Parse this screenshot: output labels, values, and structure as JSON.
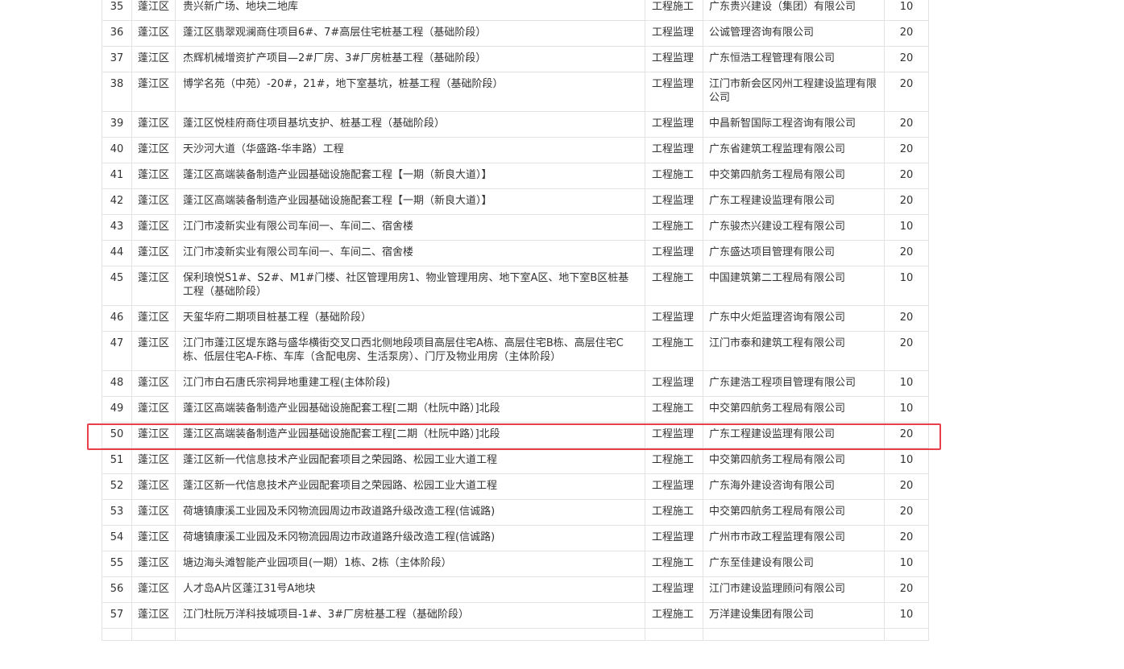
{
  "table": {
    "rows": [
      {
        "no": "35",
        "district": "蓬江区",
        "project": "贵兴新广场、地块二地库",
        "type": "工程施工",
        "company": "广东贵兴建设（集团）有限公司",
        "score": "10"
      },
      {
        "no": "36",
        "district": "蓬江区",
        "project": "蓬江区翡翠观澜商住项目6#、7#高层住宅桩基工程（基础阶段）",
        "type": "工程监理",
        "company": "公诚管理咨询有限公司",
        "score": "20"
      },
      {
        "no": "37",
        "district": "蓬江区",
        "project": "杰辉机械增资扩产项目—2#厂房、3#厂房桩基工程（基础阶段）",
        "type": "工程监理",
        "company": "广东恒浩工程管理有限公司",
        "score": "20"
      },
      {
        "no": "38",
        "district": "蓬江区",
        "project": "博学名苑（中苑）-20#，21#，地下室基坑，桩基工程（基础阶段）",
        "type": "工程监理",
        "company": "江门市新会区冈州工程建设监理有限公司",
        "score": "20"
      },
      {
        "no": "39",
        "district": "蓬江区",
        "project": "蓬江区悦桂府商住项目基坑支护、桩基工程（基础阶段）",
        "type": "工程监理",
        "company": "中昌新智国际工程咨询有限公司",
        "score": "20"
      },
      {
        "no": "40",
        "district": "蓬江区",
        "project": "天沙河大道（华盛路-华丰路）工程",
        "type": "工程监理",
        "company": "广东省建筑工程监理有限公司",
        "score": "20"
      },
      {
        "no": "41",
        "district": "蓬江区",
        "project": "蓬江区高端装备制造产业园基础设施配套工程【一期（新良大道）】",
        "type": "工程施工",
        "company": "中交第四航务工程局有限公司",
        "score": "20"
      },
      {
        "no": "42",
        "district": "蓬江区",
        "project": "蓬江区高端装备制造产业园基础设施配套工程【一期（新良大道）】",
        "type": "工程监理",
        "company": "广东工程建设监理有限公司",
        "score": "20"
      },
      {
        "no": "43",
        "district": "蓬江区",
        "project": "江门市凌新实业有限公司车间一、车间二、宿舍楼",
        "type": "工程施工",
        "company": "广东骏杰兴建设工程有限公司",
        "score": "10"
      },
      {
        "no": "44",
        "district": "蓬江区",
        "project": "江门市凌新实业有限公司车间一、车间二、宿舍楼",
        "type": "工程监理",
        "company": "广东盛达项目管理有限公司",
        "score": "20"
      },
      {
        "no": "45",
        "district": "蓬江区",
        "project": "保利琅悦S1#、S2#、M1#门楼、社区管理用房1、物业管理用房、地下室A区、地下室B区桩基工程（基础阶段）",
        "type": "工程施工",
        "company": "中国建筑第二工程局有限公司",
        "score": "10"
      },
      {
        "no": "46",
        "district": "蓬江区",
        "project": "天玺华府二期项目桩基工程（基础阶段）",
        "type": "工程监理",
        "company": "广东中火炬监理咨询有限公司",
        "score": "20"
      },
      {
        "no": "47",
        "district": "蓬江区",
        "project": "江门市蓬江区堤东路与盛华横街交叉口西北侧地段项目高层住宅A栋、高层住宅B栋、高层住宅C栋、低层住宅A-F栋、车库（含配电房、生活泵房）、门厅及物业用房（主体阶段）",
        "type": "工程施工",
        "company": "江门市泰和建筑工程有限公司",
        "score": "20"
      },
      {
        "no": "48",
        "district": "蓬江区",
        "project": "江门市白石唐氏宗祠异地重建工程(主体阶段)",
        "type": "工程监理",
        "company": "广东建浩工程项目管理有限公司",
        "score": "10"
      },
      {
        "no": "49",
        "district": "蓬江区",
        "project": "蓬江区高端装备制造产业园基础设施配套工程[二期（杜阮中路）]北段",
        "type": "工程施工",
        "company": "中交第四航务工程局有限公司",
        "score": "10"
      },
      {
        "no": "50",
        "district": "蓬江区",
        "project": "蓬江区高端装备制造产业园基础设施配套工程[二期（杜阮中路）]北段",
        "type": "工程监理",
        "company": "广东工程建设监理有限公司",
        "score": "20"
      },
      {
        "no": "51",
        "district": "蓬江区",
        "project": "蓬江区新一代信息技术产业园配套项目之荣园路、松园工业大道工程",
        "type": "工程施工",
        "company": "中交第四航务工程局有限公司",
        "score": "10"
      },
      {
        "no": "52",
        "district": "蓬江区",
        "project": "蓬江区新一代信息技术产业园配套项目之荣园路、松园工业大道工程",
        "type": "工程监理",
        "company": "广东海外建设咨询有限公司",
        "score": "20"
      },
      {
        "no": "53",
        "district": "蓬江区",
        "project": "荷塘镇康溪工业园及禾冈物流园周边市政道路升级改造工程(信诚路)",
        "type": "工程施工",
        "company": "中交第四航务工程局有限公司",
        "score": "20"
      },
      {
        "no": "54",
        "district": "蓬江区",
        "project": "荷塘镇康溪工业园及禾冈物流园周边市政道路升级改造工程(信诚路)",
        "type": "工程监理",
        "company": "广州市市政工程监理有限公司",
        "score": "20"
      },
      {
        "no": "55",
        "district": "蓬江区",
        "project": "塘边海头滩智能产业园项目(一期）1栋、2栋（主体阶段）",
        "type": "工程施工",
        "company": "广东至佳建设有限公司",
        "score": "10"
      },
      {
        "no": "56",
        "district": "蓬江区",
        "project": "人才岛A片区蓬江31号A地块",
        "type": "工程监理",
        "company": "江门市建设监理顾问有限公司",
        "score": "20"
      },
      {
        "no": "57",
        "district": "蓬江区",
        "project": "江门杜阮万洋科技城项目-1#、3#厂房桩基工程（基础阶段）",
        "type": "工程施工",
        "company": "万洋建设集团有限公司",
        "score": "10"
      },
      {
        "no": "",
        "district": "",
        "project": "",
        "type": "",
        "company": "",
        "score": ""
      }
    ]
  }
}
